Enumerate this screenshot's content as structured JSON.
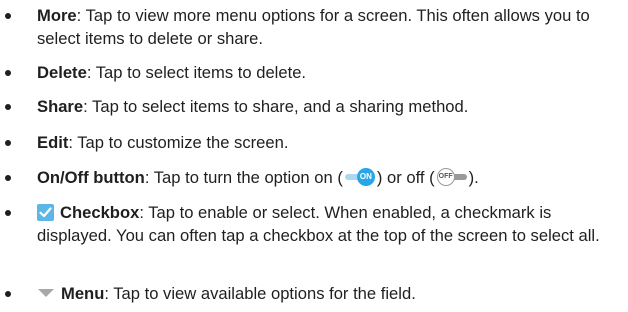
{
  "items": [
    {
      "term": "More",
      "desc": ": Tap to view more menu options for a screen. This often allows you to select items to delete or share."
    },
    {
      "term": "Delete",
      "desc": ": Tap to select items to delete."
    },
    {
      "term": "Share",
      "desc": ": Tap to select items to share, and a sharing method."
    },
    {
      "term": "Edit",
      "desc": ": Tap to customize the screen."
    },
    {
      "term": "On/Off button",
      "desc_before": ": Tap to turn the option on (",
      "desc_middle": ") or off (",
      "desc_after": ").",
      "on_label": "ON",
      "off_label": "OFF"
    },
    {
      "term": "Checkbox",
      "desc": ": Tap to enable or select. When enabled, a checkmark is displayed. You can often tap a checkbox at the top of the screen to select all.",
      "icon": "checkbox-icon"
    },
    {
      "term": "Menu",
      "desc": ": Tap to view available options for the field.",
      "icon": "dropdown-triangle-icon"
    }
  ],
  "colors": {
    "text": "#1f1f1f",
    "toggle_on": "#29a6e8",
    "checkbox": "#5cb7e6",
    "triangle": "#a7a7a7"
  }
}
